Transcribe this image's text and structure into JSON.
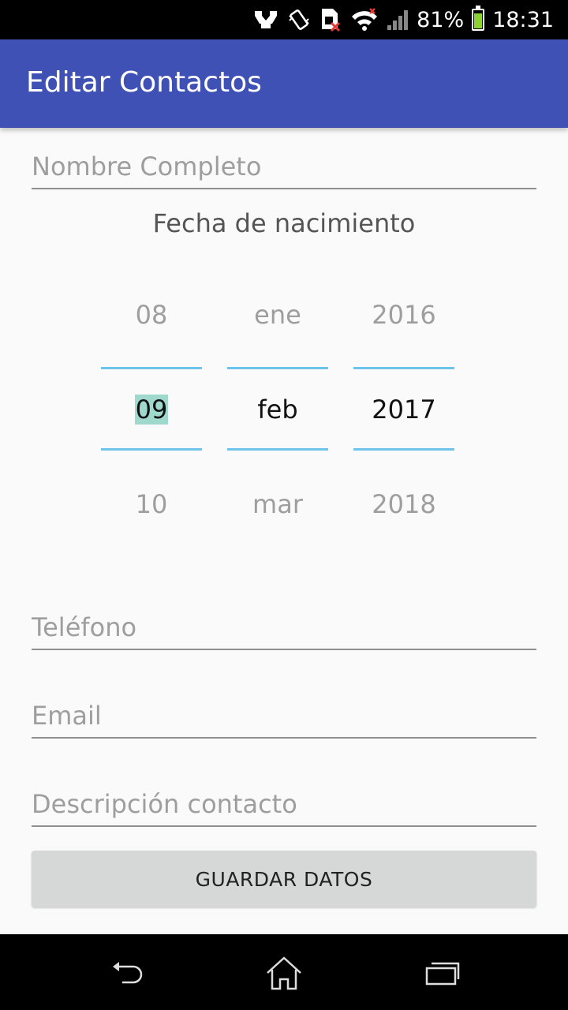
{
  "status_bar": {
    "battery": "81%",
    "time": "18:31",
    "icons": [
      "nfc-icon",
      "vibrate-icon",
      "sim-error-icon",
      "wifi-icon",
      "signal-icon",
      "battery-icon"
    ]
  },
  "app_bar": {
    "title": "Editar Contactos"
  },
  "form": {
    "full_name_placeholder": "Nombre Completo",
    "birth_label": "Fecha de nacimiento",
    "phone_placeholder": "Teléfono",
    "email_placeholder": "Email",
    "description_placeholder": "Descripción contacto",
    "save_label": "GUARDAR DATOS"
  },
  "date_picker": {
    "day": {
      "prev": "08",
      "current": "09",
      "next": "10"
    },
    "month": {
      "prev": "ene",
      "current": "feb",
      "next": "mar"
    },
    "year": {
      "prev": "2016",
      "current": "2017",
      "next": "2018"
    }
  },
  "nav_bar": {
    "icons": [
      "back-icon",
      "home-icon",
      "recent-apps-icon"
    ]
  },
  "colors": {
    "app_bar": "#3f51b5",
    "picker_accent": "#6cc5e9",
    "selection": "#9fd8cc",
    "battery_fill": "#8bd12f"
  }
}
